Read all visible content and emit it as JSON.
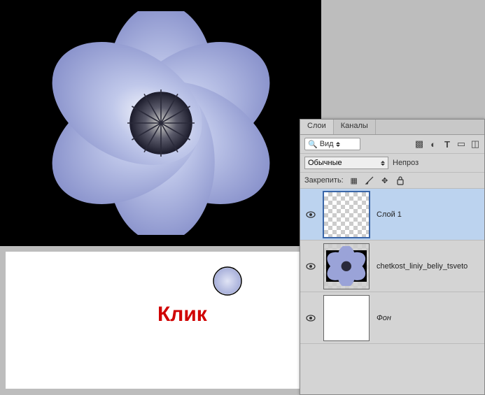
{
  "panel": {
    "tabs": {
      "layers": "Слои",
      "channels": "Каналы"
    },
    "search_label": "Вид",
    "blend_mode": "Обычные",
    "opacity_label": "Непроз",
    "lock_label": "Закрепить:"
  },
  "layers": [
    {
      "name": "Слой 1",
      "visible": true,
      "selected": true,
      "thumb": "transparent"
    },
    {
      "name": "chetkost_liniy_beliy_tsveto",
      "visible": true,
      "selected": false,
      "thumb": "flower"
    },
    {
      "name": "Фон",
      "visible": true,
      "selected": false,
      "thumb": "white",
      "italic": true
    }
  ],
  "annotation": {
    "click": "Клик"
  },
  "icons": {
    "image": "image-filter-icon",
    "adj": "circle-half-icon",
    "type": "T",
    "mask": "mask-icon",
    "pixels": "pixels-icon",
    "brush": "brush-icon",
    "move": "move-icon",
    "lock": "lock-icon"
  }
}
